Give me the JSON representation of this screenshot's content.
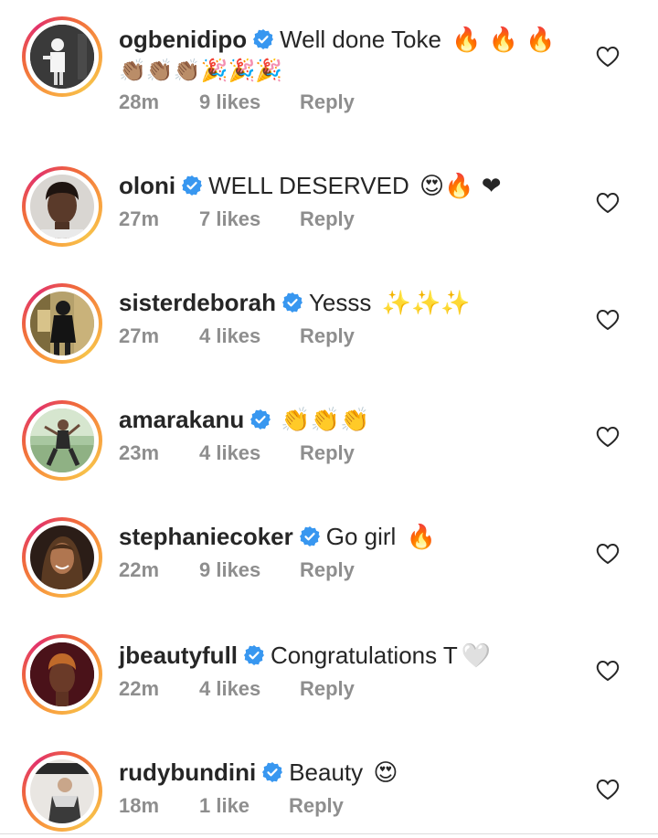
{
  "comments": [
    {
      "username": "ogbenidipo",
      "text": "Well done Toke",
      "emojis_inline": "🔥 🔥 🔥",
      "emojis_line2": "👏🏽👏🏽👏🏽🎉🎉🎉",
      "time": "28m",
      "likes": "9 likes",
      "reply": "Reply"
    },
    {
      "username": "oloni",
      "text": "WELL DESERVED",
      "emojis_inline": "😍🔥 ❤",
      "emojis_line2": "",
      "time": "27m",
      "likes": "7 likes",
      "reply": "Reply"
    },
    {
      "username": "sisterdeborah",
      "text": "Yesss",
      "emojis_inline": "✨✨✨",
      "emojis_line2": "",
      "time": "27m",
      "likes": "4 likes",
      "reply": "Reply"
    },
    {
      "username": "amarakanu",
      "text": "",
      "emojis_inline": "👏👏👏",
      "emojis_line2": "",
      "time": "23m",
      "likes": "4 likes",
      "reply": "Reply"
    },
    {
      "username": "stephaniecoker",
      "text": "Go girl",
      "emojis_inline": "🔥",
      "emojis_line2": "",
      "time": "22m",
      "likes": "9 likes",
      "reply": "Reply"
    },
    {
      "username": "jbeautyfull",
      "text": "Congratulations T",
      "emojis_inline": "🤍",
      "emojis_line2": "",
      "time": "22m",
      "likes": "4 likes",
      "reply": "Reply"
    },
    {
      "username": "rudybundini",
      "text": "Beauty",
      "emojis_inline": "😍",
      "emojis_line2": "",
      "time": "18m",
      "likes": "1 like",
      "reply": "Reply"
    }
  ],
  "colors": {
    "verified_blue": "#3897f0",
    "meta_gray": "#8e8e8e",
    "text": "#262626"
  },
  "icons": {
    "verified": "verified-badge-icon",
    "like": "heart-outline-icon"
  }
}
